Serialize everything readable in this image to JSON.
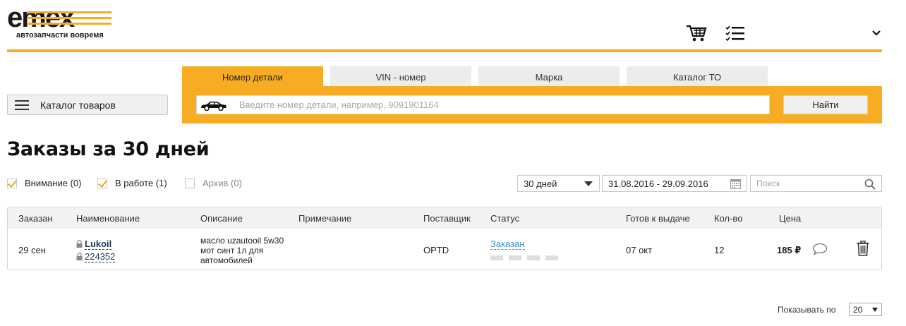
{
  "header": {
    "logo_text": "emex",
    "tagline": "автозапчасти вовремя",
    "accent_color": "#f6ad23"
  },
  "catalog_button": {
    "label": "Каталог товаров"
  },
  "search": {
    "tabs": [
      {
        "label": "Номер детали",
        "active": true
      },
      {
        "label": "VIN - номер",
        "active": false
      },
      {
        "label": "Марка",
        "active": false
      },
      {
        "label": "Каталог ТО",
        "active": false
      }
    ],
    "placeholder": "Введите номер детали, например, 9091901164",
    "value": "",
    "button_label": "Найти"
  },
  "page_title": "Заказы за 30 дней",
  "filters": {
    "attention": {
      "label": "Внимание (0)",
      "checked": true
    },
    "in_progress": {
      "label": "В работе (1)",
      "checked": true
    },
    "archive": {
      "label": "Архив (0)",
      "checked": false
    },
    "period": {
      "selected": "30 дней"
    },
    "date_range": "31.08.2016 - 29.09.2016",
    "search_placeholder": "Поиск"
  },
  "table": {
    "columns": [
      "Заказан",
      "Наименование",
      "Описание",
      "Примечание",
      "Поставщик",
      "Статус",
      "Готов к выдаче",
      "Кол-во",
      "Цена"
    ],
    "rows": [
      {
        "ordered": "29 сен",
        "brand": "Lukoil",
        "article": "224352",
        "description": "масло uzautooil 5w30 мот синт 1л для автомобилей",
        "note": "",
        "supplier": "OPTD",
        "status": "Заказан",
        "ready": "07 окт",
        "qty": "12",
        "price": "185 ₽"
      }
    ]
  },
  "pager": {
    "label": "Показывать по",
    "selected": "20"
  }
}
